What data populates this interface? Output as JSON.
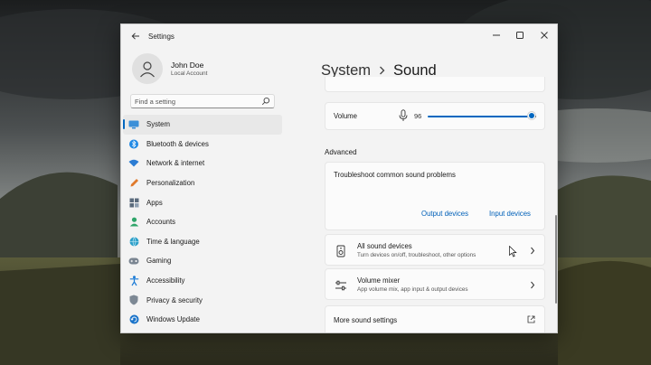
{
  "window": {
    "title": "Settings"
  },
  "user": {
    "name": "John Doe",
    "account_type": "Local Account"
  },
  "search": {
    "placeholder": "Find a setting"
  },
  "nav": {
    "items": [
      {
        "label": "System",
        "icon": "monitor-icon",
        "active": true
      },
      {
        "label": "Bluetooth & devices",
        "icon": "bluetooth-icon"
      },
      {
        "label": "Network & internet",
        "icon": "wifi-icon"
      },
      {
        "label": "Personalization",
        "icon": "pencil-icon"
      },
      {
        "label": "Apps",
        "icon": "apps-icon"
      },
      {
        "label": "Accounts",
        "icon": "person-icon"
      },
      {
        "label": "Time & language",
        "icon": "globe-icon"
      },
      {
        "label": "Gaming",
        "icon": "gamepad-icon"
      },
      {
        "label": "Accessibility",
        "icon": "accessibility-icon"
      },
      {
        "label": "Privacy & security",
        "icon": "shield-icon"
      },
      {
        "label": "Windows Update",
        "icon": "update-icon"
      }
    ]
  },
  "breadcrumb": {
    "parent": "System",
    "current": "Sound"
  },
  "volume": {
    "label": "Volume",
    "value": "96",
    "level_percent": 96
  },
  "advanced": {
    "heading": "Advanced",
    "troubleshoot": {
      "title": "Troubleshoot common sound problems",
      "output_link": "Output devices",
      "input_link": "Input devices"
    },
    "all_devices": {
      "title": "All sound devices",
      "subtitle": "Turn devices on/off, troubleshoot, other options"
    },
    "mixer": {
      "title": "Volume mixer",
      "subtitle": "App volume mix, app input & output devices"
    },
    "more": {
      "label": "More sound settings"
    }
  },
  "colors": {
    "accent": "#0067c0",
    "link": "#0060b8",
    "window_bg": "#f3f3f3",
    "card_bg": "#fbfbfb"
  }
}
